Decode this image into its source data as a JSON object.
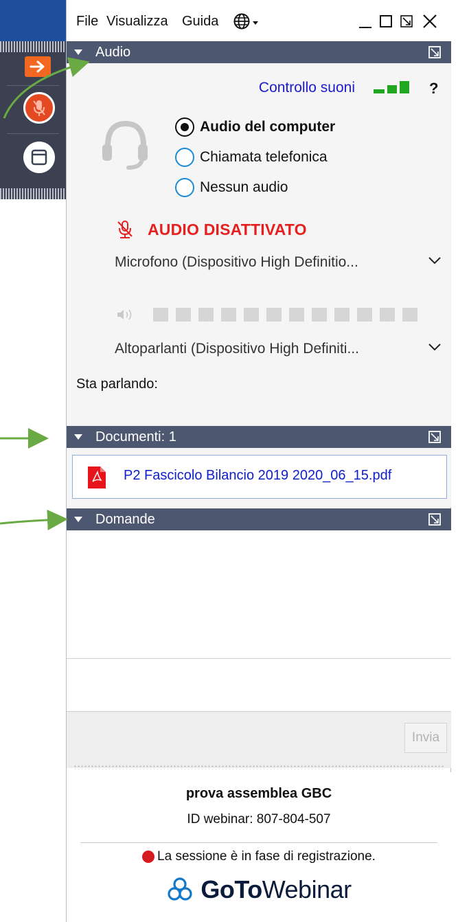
{
  "menu": {
    "file": "File",
    "view": "Visualizza",
    "help": "Guida"
  },
  "icons": {
    "language": "globe-icon",
    "minimize": "minimize-icon",
    "maximize": "maximize-icon",
    "restore": "restore-icon",
    "close": "close-icon"
  },
  "left_strip": {
    "buttons": [
      "arrow-right-icon",
      "microphone-muted-icon",
      "window-icon"
    ]
  },
  "audio": {
    "header": "Audio",
    "sound_check": "Controllo suoni",
    "help": "?",
    "options": [
      {
        "label": "Audio del computer",
        "selected": true
      },
      {
        "label": "Chiamata telefonica",
        "selected": false
      },
      {
        "label": "Nessun audio",
        "selected": false
      }
    ],
    "muted_status": "AUDIO DISATTIVATO",
    "microphone": "Microfono (Dispositivo High Definitio...",
    "speakers": "Altoparlanti (Dispositivo High Definiti...",
    "speaker_level": 0,
    "speaking_label": "Sta parlando:"
  },
  "documents": {
    "header": "Documenti: 1",
    "files": [
      {
        "name": "P2 Fascicolo Bilancio 2019 2020_06_15.pdf"
      }
    ]
  },
  "questions": {
    "header": "Domande",
    "send": "Invia"
  },
  "footer": {
    "webinar_name": "prova assemblea GBC",
    "webinar_id": "ID webinar: 807-804-507",
    "recording": "La sessione è in fase di registrazione.",
    "brand_bold": "GoTo",
    "brand_regular": "Webinar"
  },
  "colors": {
    "header_bg": "#4d5770",
    "accent_orange": "#f26722",
    "muted_red": "#e62020",
    "link_blue": "#1b1bcc",
    "level_green": "#1fa81f",
    "annotation_green": "#6aaa44"
  }
}
